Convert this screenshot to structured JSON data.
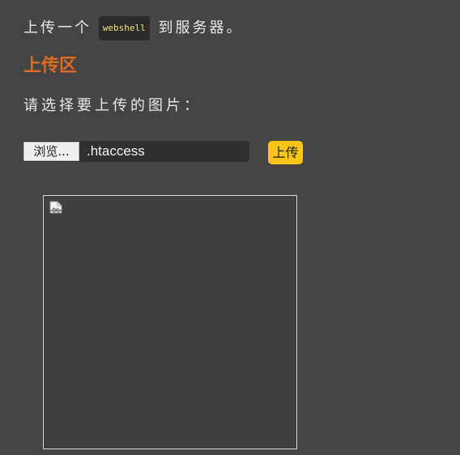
{
  "intro": {
    "before": "上传一个",
    "code": "webshell",
    "after": "到服务器。"
  },
  "section_title": "上传区",
  "prompt": "请选择要上传的图片：",
  "file_picker": {
    "browse_label": "浏览...",
    "file_name": ".htaccess"
  },
  "upload_button": {
    "label": "上传"
  },
  "preview": {
    "icon": "broken-image-icon"
  },
  "colors": {
    "background": "#454545",
    "text": "#e8e8e8",
    "heading": "#e26a1c",
    "code": "#f2e66d",
    "upload_button": "#f7c517"
  }
}
